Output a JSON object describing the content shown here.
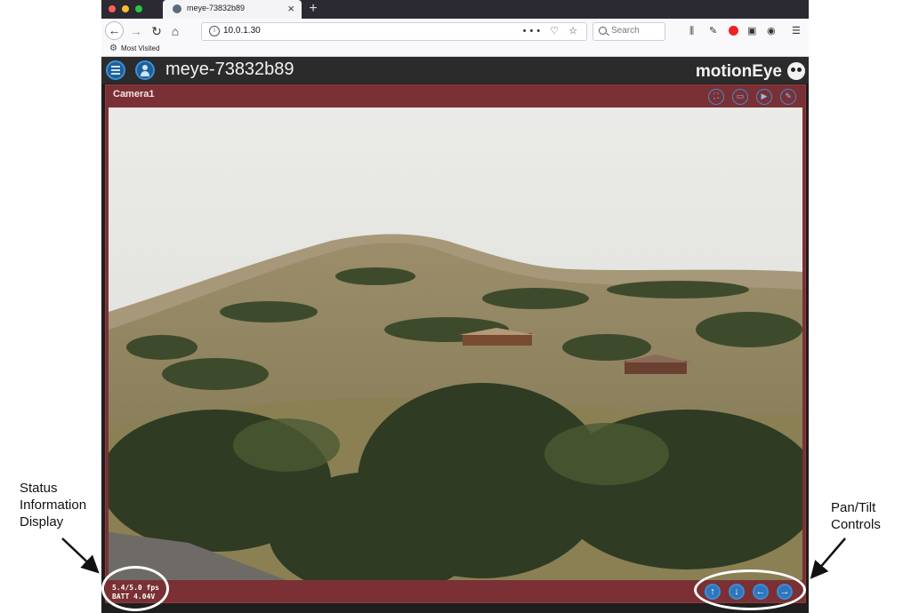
{
  "browser": {
    "tab_title": "meye-73832b89",
    "tab_close": "×",
    "new_tab": "+",
    "url": "10.0.1.30",
    "url_actions": "••• ♡ ☆",
    "search_placeholder": "Search",
    "bookmark_label": "Most Visited"
  },
  "app": {
    "hostname": "meye-73832b89",
    "brand": "motionEye"
  },
  "camera": {
    "name": "Camera1",
    "status_line1": "5.4/5.0 fps",
    "status_line2": "BATT 4.04V"
  },
  "annotations": {
    "left_label": [
      "Status",
      "Information",
      "Display"
    ],
    "right_label": [
      "Pan/Tilt",
      "Controls"
    ]
  },
  "colors": {
    "frame": "#7a3034",
    "accent_blue": "#3f8bd1",
    "topbar": "#2b2b2b"
  },
  "icons": {
    "camera_actions": [
      "fullscreen-icon",
      "pictures-icon",
      "play-icon",
      "settings-wrench-icon"
    ],
    "pan_tilt": [
      "arrow-up-icon",
      "arrow-down-icon",
      "arrow-left-icon",
      "arrow-right-icon"
    ]
  }
}
